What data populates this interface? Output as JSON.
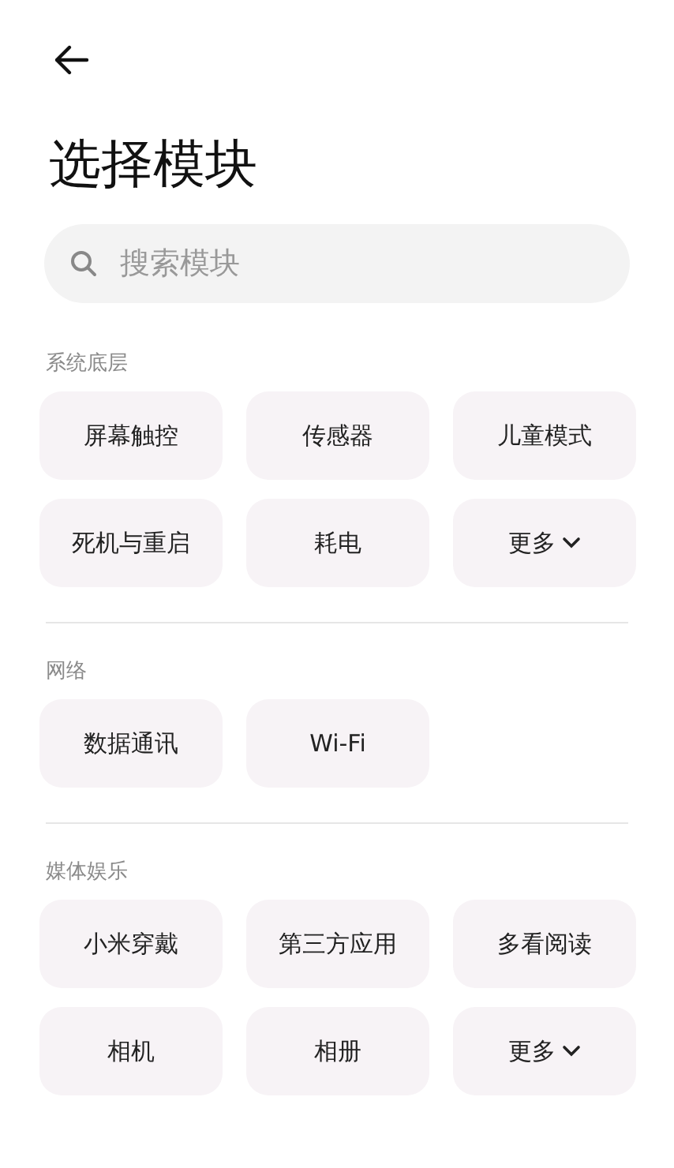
{
  "title": "选择模块",
  "search": {
    "placeholder": "搜索模块"
  },
  "sections": [
    {
      "label": "系统底层",
      "items": [
        {
          "kind": "module",
          "label": "屏幕触控"
        },
        {
          "kind": "module",
          "label": "传感器"
        },
        {
          "kind": "module",
          "label": "儿童模式"
        },
        {
          "kind": "module",
          "label": "死机与重启"
        },
        {
          "kind": "module",
          "label": "耗电"
        },
        {
          "kind": "more",
          "label": "更多"
        }
      ]
    },
    {
      "label": "网络",
      "items": [
        {
          "kind": "module",
          "label": "数据通讯"
        },
        {
          "kind": "module",
          "label": "Wi-Fi"
        }
      ]
    },
    {
      "label": "媒体娱乐",
      "items": [
        {
          "kind": "module",
          "label": "小米穿戴"
        },
        {
          "kind": "module",
          "label": "第三方应用"
        },
        {
          "kind": "module",
          "label": "多看阅读"
        },
        {
          "kind": "module",
          "label": "相机"
        },
        {
          "kind": "module",
          "label": "相册"
        },
        {
          "kind": "more",
          "label": "更多"
        }
      ]
    }
  ]
}
